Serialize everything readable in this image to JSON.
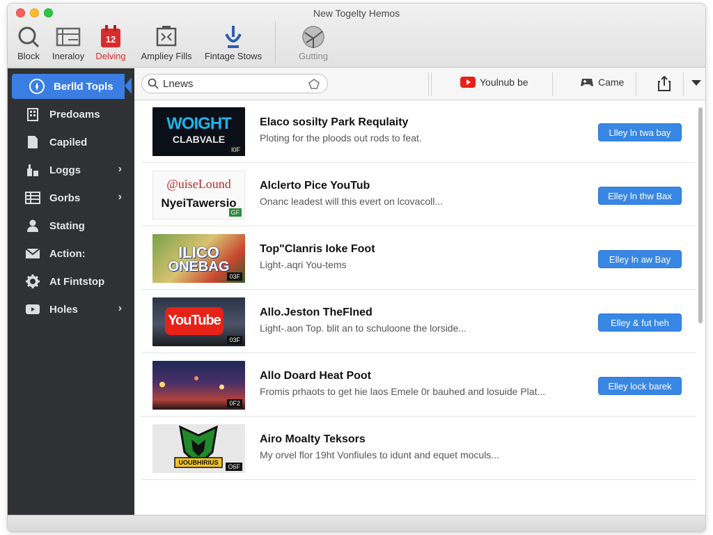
{
  "window": {
    "title": "New Togelty Hemos"
  },
  "toolbar": {
    "items": [
      {
        "label": "Block",
        "icon": "search-icon"
      },
      {
        "label": "Ineraloy",
        "icon": "ruler-icon"
      },
      {
        "label": "Delving",
        "icon": "calendar-icon",
        "badge": "12"
      },
      {
        "label": "Ampliey Fills",
        "icon": "crop-icon"
      },
      {
        "label": "Fintage Stows",
        "icon": "download-icon"
      },
      {
        "label": "Gutting",
        "icon": "globe-icon"
      }
    ]
  },
  "sidebar": {
    "items": [
      {
        "label": "Berlld Topls",
        "icon": "compass-icon",
        "active": true
      },
      {
        "label": "Predoams",
        "icon": "building-icon"
      },
      {
        "label": "Capiled",
        "icon": "document-icon"
      },
      {
        "label": "Loggs",
        "icon": "tools-icon",
        "chevron": true
      },
      {
        "label": "Gorbs",
        "icon": "grid-icon",
        "chevron": true
      },
      {
        "label": "Stating",
        "icon": "person-icon"
      },
      {
        "label": "Action:",
        "icon": "envelope-icon"
      },
      {
        "label": "At Fintstop",
        "icon": "gear-icon"
      },
      {
        "label": "Holes",
        "icon": "video-icon",
        "chevron": true
      }
    ]
  },
  "search": {
    "value": "Lnews"
  },
  "actions": {
    "youtube_label": "Youlnub be",
    "game_label": "Came"
  },
  "rows": [
    {
      "title": "Elaco sosilty Park Requlaity",
      "desc": "Ploting for the ploods out rods to feat.",
      "button": "Llley ln twa bay",
      "thumb_text_1": "WOIGHT",
      "thumb_text_2": "CLABVALE",
      "badge": "I0F"
    },
    {
      "title": "Alclerto Pice YouTub",
      "desc": "Onanc leadest will this evert on lcovacoll...",
      "button": "Elley ln thw Bax",
      "thumb_text_1": "@uiseLound",
      "thumb_text_2": "NyeiTawersio",
      "badge": "GF"
    },
    {
      "title": "Top\"Clanris Ioke Foot",
      "desc": "Light-.aqri You-tems",
      "button": "Elley ln aw Bay",
      "thumb_text_1": "ILICO",
      "thumb_text_2": "ONEBAG",
      "badge": "03F"
    },
    {
      "title": "Allo.Jeston TheFlned",
      "desc": "Light-.aon Top. blit an to schuloone the lorside...",
      "button": "Elley & fut heh",
      "thumb_text_1": "YouTube",
      "thumb_text_2": "",
      "badge": "03F"
    },
    {
      "title": "Allo Doard Heat Poot",
      "desc": "Fromis prhaots to get hie laos Emele 0r bauhed and losuide Plat...",
      "button": "Elley lock barek",
      "thumb_text_1": "",
      "thumb_text_2": "",
      "badge": "0F2"
    },
    {
      "title": "Airo Moalty Teksors",
      "desc": "My orvel flor 19ht Vonfiules to idunt and equet moculs...",
      "button": "",
      "thumb_text_1": "UOUBHIRIUS",
      "thumb_text_2": "",
      "badge": "O6F"
    }
  ]
}
